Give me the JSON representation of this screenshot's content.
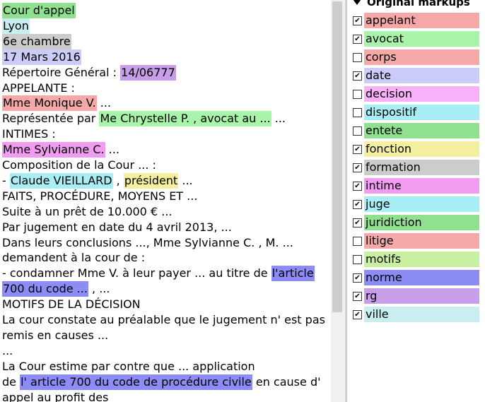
{
  "document": {
    "lines": [
      [
        {
          "t": "Cour d'appel",
          "c": "#90e090"
        }
      ],
      [
        {
          "t": "Lyon",
          "c": "#c8eef0"
        }
      ],
      [
        {
          "t": "6e chambre",
          "c": "#cccccc"
        }
      ],
      [
        {
          "t": "17 Mars 2016",
          "c": "#ccccf8"
        }
      ],
      [
        {
          "t": "Répertoire Général : "
        },
        {
          "t": " 14/06777 ",
          "c": "#c89ee8"
        }
      ],
      [
        {
          "t": "APPELANTE :"
        }
      ],
      [
        {
          "t": "Mme Monique V.",
          "c": "#f4a8a8"
        },
        {
          "t": "  ..."
        }
      ],
      [
        {
          "t": "Représentée par  "
        },
        {
          "t": " Me Chrystelle P. , avocat au ... ",
          "c": "#a8f4a8"
        },
        {
          "t": "  ..."
        }
      ],
      [
        {
          "t": "INTIMES :"
        }
      ],
      [
        {
          "t": "Mme Sylvianne C.",
          "c": "#f09cf0"
        },
        {
          "t": "  ..."
        }
      ],
      [
        {
          "t": "Composition de la Cour ... :"
        }
      ],
      [
        {
          "t": "- "
        },
        {
          "t": " Claude VIEILLARD ",
          "c": "#a8eef4"
        },
        {
          "t": " , "
        },
        {
          "t": " président ",
          "c": "#f4f0a0"
        },
        {
          "t": " ..."
        }
      ],
      [
        {
          "t": "FAITS, PROCÉDURE, MOYENS ET  ..."
        }
      ],
      [
        {
          "t": "Suite à un prêt de 10.000 € ..."
        }
      ],
      [
        {
          "t": "Par jugement en date du 4 avril 2013, ..."
        }
      ],
      [
        {
          "t": "Dans leurs conclusions ..., Mme Sylvianne C. , M. ..."
        }
      ],
      [
        {
          "t": "demandent à la cour de :"
        }
      ],
      [
        {
          "t": "- condamner Mme V. à leur payer ... au titre de  "
        },
        {
          "t": " l'article ",
          "c": "#8c8cf4"
        }
      ],
      [
        {
          "t": "700 du code ... ",
          "c": "#8c8cf4"
        },
        {
          "t": " , ..."
        }
      ],
      [
        {
          "t": "MOTIFS DE LA DÉCISION"
        }
      ],
      [
        {
          "t": "La cour constate au préalable que le jugement n' est pas"
        }
      ],
      [
        {
          "t": "remis en causes ..."
        }
      ],
      [
        {
          "t": "..."
        }
      ],
      [
        {
          "t": "La Cour estime par contre que ... application"
        }
      ],
      [
        {
          "t": "de  "
        },
        {
          "t": " l' article 700 du code de procédure civile ",
          "c": "#8c8cf4"
        },
        {
          "t": "  en cause d'"
        }
      ],
      [
        {
          "t": "appel au profit des"
        }
      ]
    ]
  },
  "panel": {
    "title": "Original markups",
    "items": [
      {
        "label": "appelant",
        "color": "#f4a8a8",
        "checked": true
      },
      {
        "label": "avocat",
        "color": "#a8f4a8",
        "checked": true
      },
      {
        "label": "corps",
        "color": "#f4a8a8",
        "checked": false
      },
      {
        "label": "date",
        "color": "#ccccf8",
        "checked": true
      },
      {
        "label": "decision",
        "color": "#f8b0f8",
        "checked": false
      },
      {
        "label": "dispositif",
        "color": "#a8eef4",
        "checked": false
      },
      {
        "label": "entete",
        "color": "#90e090",
        "checked": false
      },
      {
        "label": "fonction",
        "color": "#f4f0a0",
        "checked": true
      },
      {
        "label": "formation",
        "color": "#cccccc",
        "checked": true
      },
      {
        "label": "intime",
        "color": "#f09cf0",
        "checked": true
      },
      {
        "label": "juge",
        "color": "#a8eef4",
        "checked": true
      },
      {
        "label": "juridiction",
        "color": "#90e090",
        "checked": true
      },
      {
        "label": "litige",
        "color": "#f4a8a8",
        "checked": false
      },
      {
        "label": "motifs",
        "color": "#c8f0a0",
        "checked": false
      },
      {
        "label": "norme",
        "color": "#8c8cf4",
        "checked": true
      },
      {
        "label": "rg",
        "color": "#c89ee8",
        "checked": true
      },
      {
        "label": "ville",
        "color": "#c8eef0",
        "checked": true
      }
    ]
  }
}
